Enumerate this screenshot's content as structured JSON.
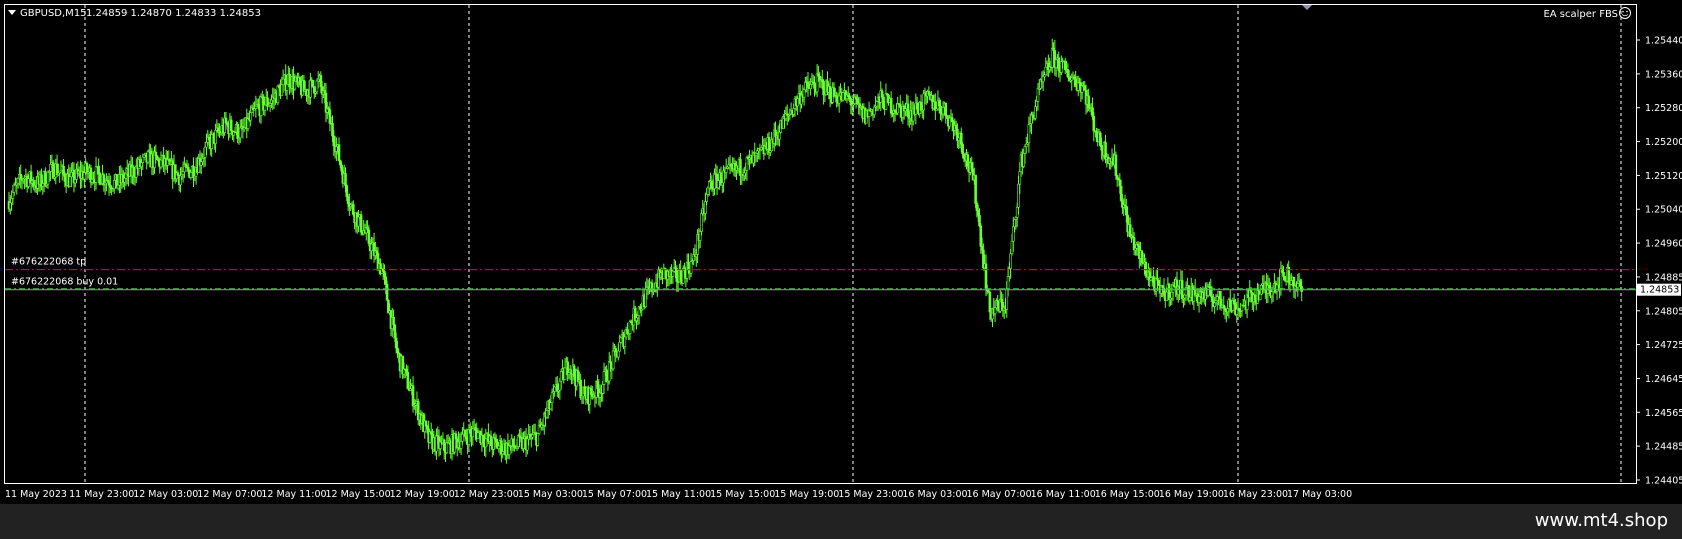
{
  "symbol_title": "GBPUSD,M15",
  "ohlc": "1.24859 1.24870 1.24833 1.24853",
  "ea_label": "EA scalper FBS",
  "tp_label": "#676222068 tp",
  "buy_label": "#676222068 buy 0.01",
  "current_price": "1.24853",
  "footer_url": "www.mt4.shop",
  "colors": {
    "background": "#000000",
    "candle": "#66ff33",
    "tp_line": "#ff0000",
    "entry_line": "#33cc33",
    "bid_line": "#aaaaaa",
    "axis_text": "#ffffff"
  },
  "chart_data": {
    "type": "line",
    "ylabels": [
      "1.25440",
      "1.25360",
      "1.25280",
      "1.25200",
      "1.25120",
      "1.25040",
      "1.24960",
      "1.24885",
      "1.24805",
      "1.24725",
      "1.24645",
      "1.24565",
      "1.24485",
      "1.24405"
    ],
    "xlabels": [
      "11 May 2023",
      "11 May 23:00",
      "12 May 03:00",
      "12 May 07:00",
      "12 May 11:00",
      "12 May 15:00",
      "12 May 19:00",
      "12 May 23:00",
      "15 May 03:00",
      "15 May 07:00",
      "15 May 11:00",
      "15 May 15:00",
      "15 May 19:00",
      "15 May 23:00",
      "16 May 03:00",
      "16 May 07:00",
      "16 May 11:00",
      "16 May 15:00",
      "16 May 19:00",
      "16 May 23:00",
      "17 May 03:00"
    ],
    "ylim": [
      1.244,
      1.2548
    ],
    "tp_price": 1.249,
    "entry_price": 1.24855,
    "series": [
      {
        "values": [
          1.2506,
          1.2512,
          1.251,
          1.2514,
          1.2511,
          1.2513,
          1.2512,
          1.251,
          1.2513,
          1.2516,
          1.2515,
          1.2512,
          1.2514,
          1.252,
          1.2524,
          1.2522,
          1.2528,
          1.253,
          1.2535,
          1.2532,
          1.2534,
          1.252,
          1.2505,
          1.2498,
          1.249,
          1.247,
          1.246,
          1.245,
          1.2448,
          1.245,
          1.2452,
          1.2449,
          1.2448,
          1.2449,
          1.2451,
          1.246,
          1.2468,
          1.246,
          1.2462,
          1.247,
          1.2478,
          1.2484,
          1.2489,
          1.2488,
          1.2492,
          1.251,
          1.2512,
          1.2514,
          1.2516,
          1.252,
          1.2526,
          1.2532,
          1.2534,
          1.2531,
          1.253,
          1.2526,
          1.253,
          1.2528,
          1.2527,
          1.253,
          1.2528,
          1.2522,
          1.251,
          1.248,
          1.2482,
          1.2515,
          1.253,
          1.254,
          1.2536,
          1.2533,
          1.252,
          1.2515,
          1.2498,
          1.249,
          1.2484,
          1.2486,
          1.2484,
          1.2484,
          1.2482,
          1.2481,
          1.2484,
          1.2486,
          1.2489,
          1.2485
        ]
      }
    ]
  }
}
